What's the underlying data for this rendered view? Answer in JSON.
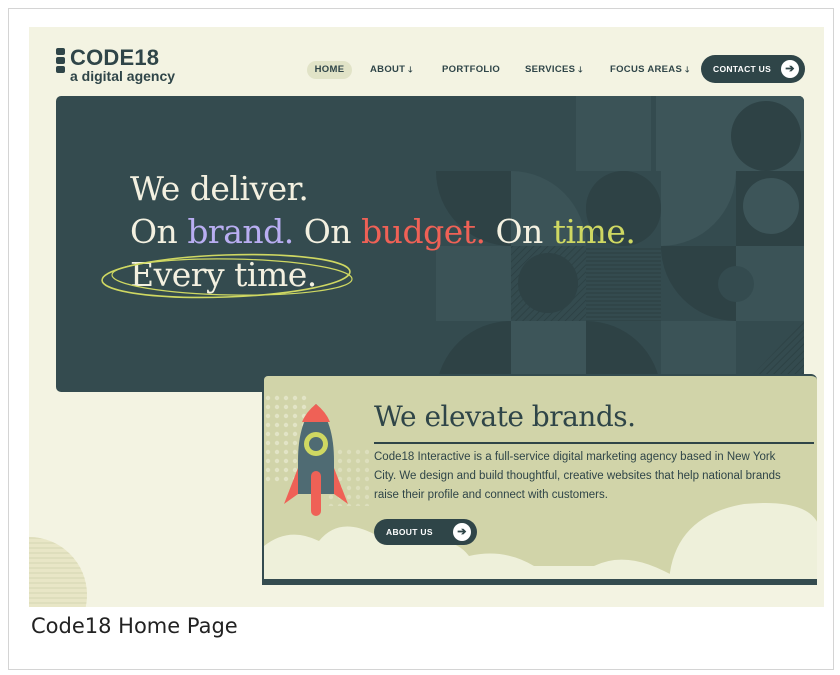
{
  "logo": {
    "name": "CODE18",
    "tagline": "a digital agency"
  },
  "nav": {
    "items": [
      {
        "label": "HOME",
        "has_dropdown": false,
        "active": true
      },
      {
        "label": "ABOUT",
        "has_dropdown": true
      },
      {
        "label": "PORTFOLIO",
        "has_dropdown": false
      },
      {
        "label": "SERVICES",
        "has_dropdown": true
      },
      {
        "label": "FOCUS AREAS",
        "has_dropdown": true
      }
    ],
    "dropdown_glyph": "🡓",
    "contact_label": "CONTACT US",
    "arrow_glyph": "➔"
  },
  "hero": {
    "line1": "We deliver.",
    "line2_parts": [
      "On ",
      "brand.",
      " On ",
      "budget.",
      " On ",
      "time."
    ],
    "line3": "Every time."
  },
  "about": {
    "title": "We elevate brands.",
    "body": "Code18 Interactive is a full-service digital marketing agency based in New York City. We design and build thoughtful, creative websites that help national brands raise their profile and connect with customers.",
    "button_label": "ABOUT US"
  },
  "caption": "Code18 Home Page",
  "colors": {
    "page_bg": "#f3f3e2",
    "dark_teal": "#344b4f",
    "brand_purple": "#b9aef2",
    "budget_red": "#ef6156",
    "time_green": "#cfd862",
    "card_bg": "#d1d4a9"
  },
  "icons": [
    "arrow-right-icon",
    "arrow-down-icon",
    "rocket-icon",
    "logo-blocks-icon"
  ]
}
